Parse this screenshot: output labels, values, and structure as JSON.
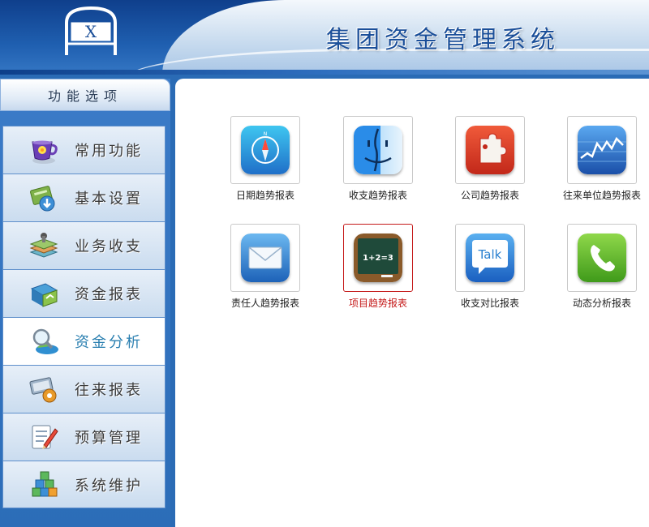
{
  "header": {
    "title": "集团资金管理系统",
    "logo_text": "X"
  },
  "sidebar": {
    "heading": "功能选项",
    "items": [
      {
        "label": "常用功能",
        "icon": "cup-icon",
        "active": false
      },
      {
        "label": "基本设置",
        "icon": "settings-icon",
        "active": false
      },
      {
        "label": "业务收支",
        "icon": "stack-icon",
        "active": false
      },
      {
        "label": "资金报表",
        "icon": "report-icon",
        "active": false
      },
      {
        "label": "资金分析",
        "icon": "analysis-icon",
        "active": true
      },
      {
        "label": "往来报表",
        "icon": "gear-card-icon",
        "active": false
      },
      {
        "label": "预算管理",
        "icon": "pencil-icon",
        "active": false
      },
      {
        "label": "系统维护",
        "icon": "blocks-icon",
        "active": false
      }
    ]
  },
  "main": {
    "tiles": [
      {
        "label": "日期趋势报表",
        "icon": "compass-icon",
        "selected": false
      },
      {
        "label": "收支趋势报表",
        "icon": "finder-icon",
        "selected": false
      },
      {
        "label": "公司趋势报表",
        "icon": "puzzle-icon",
        "selected": false
      },
      {
        "label": "往来单位趋势报表",
        "icon": "stock-chart-icon",
        "selected": false
      },
      {
        "label": "责任人趋势报表",
        "icon": "mail-icon",
        "selected": false
      },
      {
        "label": "项目趋势报表",
        "icon": "chalkboard-icon",
        "selected": true,
        "chalk_text": "1+2=3"
      },
      {
        "label": "收支对比报表",
        "icon": "talk-icon",
        "selected": false,
        "bubble_text": "Talk"
      },
      {
        "label": "动态分析报表",
        "icon": "phone-icon",
        "selected": false
      }
    ]
  }
}
